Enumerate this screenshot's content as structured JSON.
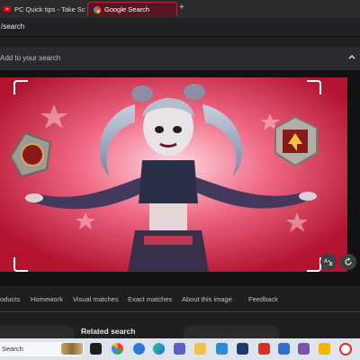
{
  "tabs": [
    {
      "label": "PC Quick tips - Take Scre",
      "icon": "youtube-icon"
    },
    {
      "label": "Google Search",
      "icon": "google-icon",
      "active": true
    }
  ],
  "address": {
    "url_fragment": "/search"
  },
  "lens": {
    "add_to_search_placeholder": "Add to your search"
  },
  "nav_tabs": [
    "oducts",
    "Homework",
    "Visual matches",
    "Exact matches",
    "About this image",
    "Feedback"
  ],
  "related": {
    "title": "Related search"
  },
  "taskbar": {
    "search_label": "Search"
  },
  "colors": {
    "accent": "#b52a3f",
    "panel": "#2a2b2e",
    "background": "#1f1f1f"
  }
}
